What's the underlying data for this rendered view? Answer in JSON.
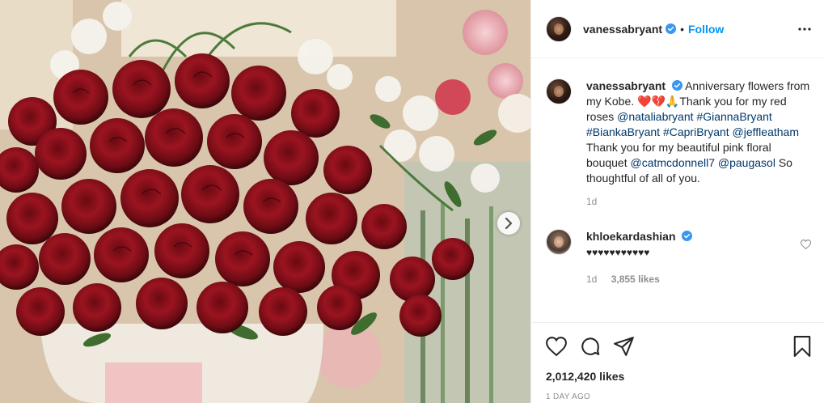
{
  "post": {
    "author": "vanessabryant",
    "follow_label": "Follow",
    "separator": "•"
  },
  "caption": {
    "username": "vanessabryant",
    "text_1": "Anniversary flowers from my Kobe. ",
    "emoji": "❤️💔🙏",
    "text_2": "Thank you for my red roses ",
    "tag_1": "@nataliabryant",
    "tag_2": "#GiannaBryant",
    "tag_3": "#BiankaBryant",
    "tag_4": "#CapriBryant",
    "tag_5": "@jeffleatham",
    "text_3": " Thank you for my beautiful pink floral bouquet ",
    "tag_6": "@catmcdonnell7",
    "tag_7": "@paugasol",
    "text_4": " So thoughtful of all of you.",
    "time": "1d"
  },
  "comment": {
    "username": "khloekardashian",
    "text": "♥♥♥♥♥♥♥♥♥♥♥",
    "time": "1d",
    "likes": "3,855 likes"
  },
  "footer": {
    "likes": "2,012,420 likes",
    "time_ago": "1 DAY AGO"
  },
  "icons": {
    "more": "more-icon",
    "next": "chevron-right-icon",
    "like": "heart-icon",
    "comment": "comment-icon",
    "share": "share-icon",
    "save": "bookmark-icon",
    "verified": "verified-badge-icon"
  },
  "colors": {
    "link": "#00376b",
    "follow": "#0095f6",
    "verified": "#3897f0",
    "muted": "#8e8e8e"
  }
}
